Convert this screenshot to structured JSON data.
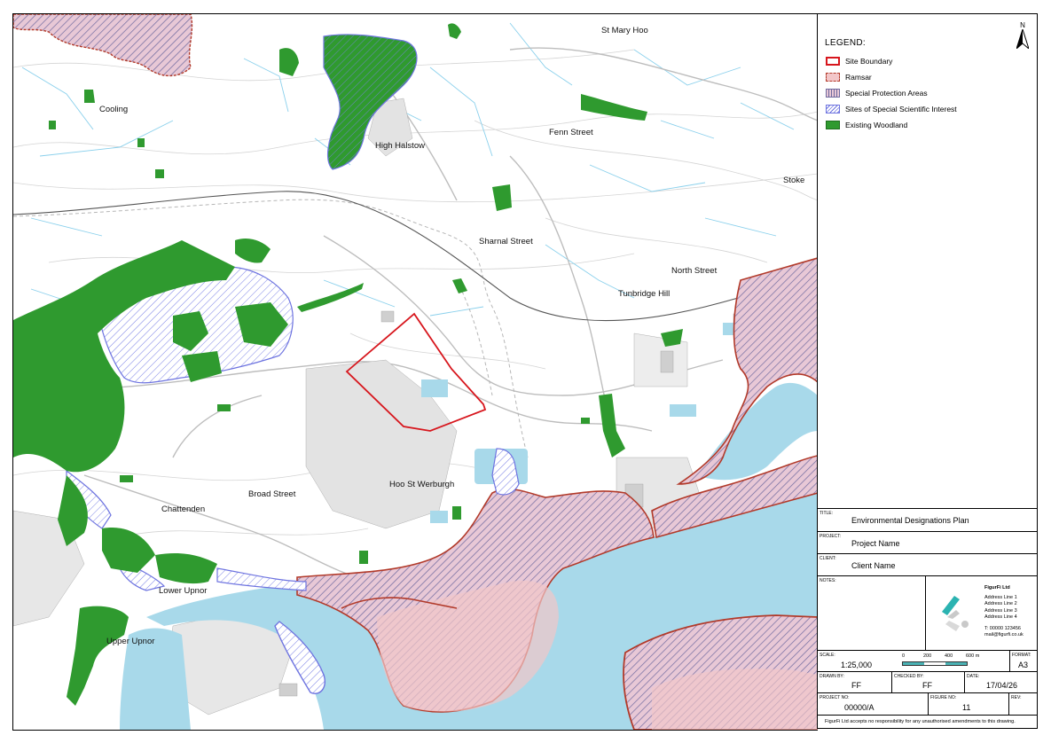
{
  "map": {
    "places": [
      {
        "id": "st-mary-hoo",
        "label": "St Mary Hoo"
      },
      {
        "id": "cooling",
        "label": "Cooling"
      },
      {
        "id": "high-halstow",
        "label": "High Halstow"
      },
      {
        "id": "fenn-street",
        "label": "Fenn Street"
      },
      {
        "id": "stoke",
        "label": "Stoke"
      },
      {
        "id": "sharnal-street",
        "label": "Sharnal Street"
      },
      {
        "id": "north-street",
        "label": "North Street"
      },
      {
        "id": "tunbridge-hill",
        "label": "Tunbridge Hill"
      },
      {
        "id": "broad-street",
        "label": "Broad Street"
      },
      {
        "id": "hoo-st-werburgh",
        "label": "Hoo St Werburgh"
      },
      {
        "id": "chattenden",
        "label": "Chattenden"
      },
      {
        "id": "lower-upnor",
        "label": "Lower Upnor"
      },
      {
        "id": "upper-upnor",
        "label": "Upper Upnor"
      }
    ],
    "colors": {
      "site_boundary": "#d7161d",
      "ramsar_stroke": "#b23a2a",
      "ramsar_fill": "#f2c6c8",
      "spa_hatch": "#6f6a9f",
      "sssi_stroke": "#6e74e0",
      "woodland": "#2f9a2f",
      "water": "#a8d9ea",
      "stream": "#8ad0ec"
    }
  },
  "panel": {
    "north_label": "N",
    "north_icon": "north-arrow-icon",
    "legend_title": "LEGEND:",
    "legend": [
      {
        "label": "Site Boundary",
        "style": "site-boundary"
      },
      {
        "label": "Ramsar",
        "style": "ramsar"
      },
      {
        "label": "Special Protection Areas",
        "style": "spa"
      },
      {
        "label": "Sites of Special Scientific Interest",
        "style": "sssi"
      },
      {
        "label": "Existing Woodland",
        "style": "woodland"
      }
    ],
    "title_label": "TITLE:",
    "title": "Environmental Designations Plan",
    "project_label": "PROJECT:",
    "project": "Project Name",
    "client_label": "CLIENT:",
    "client": "Client Name",
    "notes_label": "NOTES:",
    "company": {
      "name": "FigurFi Ltd",
      "address": [
        "Address Line 1",
        "Address Line 2",
        "Address Line 3",
        "Address Line 4"
      ],
      "phone": "T: 00000 123456",
      "email": "mail@figurfi.co.uk",
      "logo_icon": "company-logo-icon"
    },
    "scale_label": "SCALE:",
    "scale": "1:25,000",
    "scalebar_ticks": [
      "0",
      "200",
      "400",
      "600 m"
    ],
    "format_label": "FORMAT:",
    "format": "A3",
    "drawn_by_label": "DRAWN BY:",
    "drawn_by": "FF",
    "checked_by_label": "CHECKED BY:",
    "checked_by": "FF",
    "date_label": "DATE:",
    "date": "17/04/26",
    "project_no_label": "PROJECT NO:",
    "project_no": "00000/A",
    "figure_no_label": "FIGURE NO:",
    "figure_no": "11",
    "rev_label": "REV:",
    "rev": "",
    "disclaimer": "FigurFi Ltd accepts no responsibility for any unauthorised amendments to this drawing."
  }
}
